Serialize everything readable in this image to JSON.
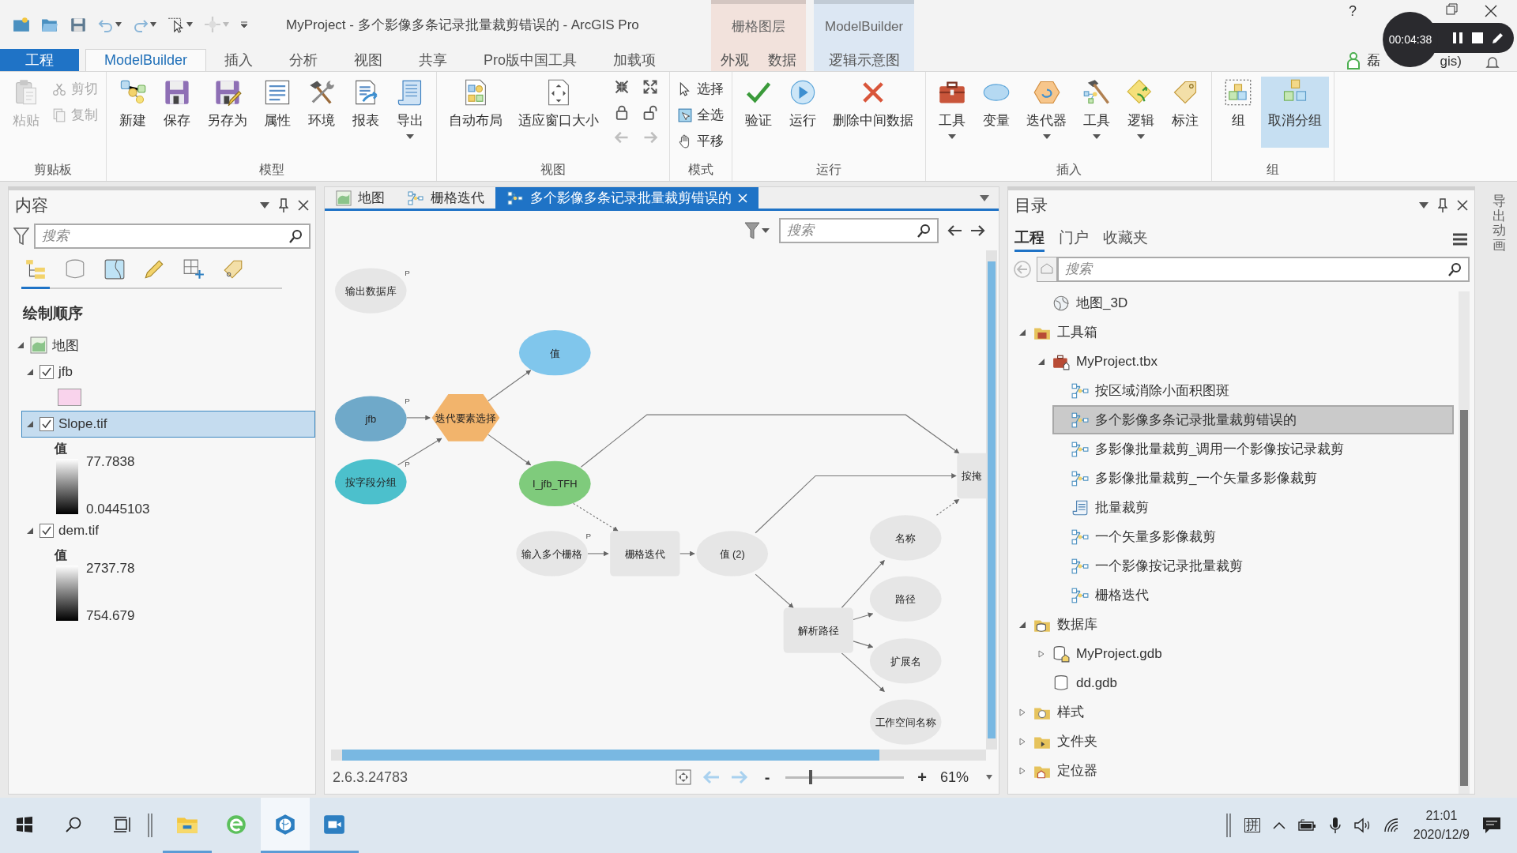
{
  "title_bar": {
    "title": "MyProject - 多个影像多条记录批量裁剪错误的 - ArcGIS Pro",
    "help": "?",
    "account": {
      "name_start": "磊",
      "name_end": "gis)"
    }
  },
  "recorder": {
    "time": "00:04:38"
  },
  "tabs": [
    {
      "label": "工程",
      "kind": "file",
      "selected": false
    },
    {
      "label": "ModelBuilder",
      "kind": "normal",
      "selected": true
    },
    {
      "label": "插入",
      "kind": "normal",
      "selected": false
    },
    {
      "label": "分析",
      "kind": "normal",
      "selected": false
    },
    {
      "label": "视图",
      "kind": "normal",
      "selected": false
    },
    {
      "label": "共享",
      "kind": "normal",
      "selected": false
    },
    {
      "label": "Pro版中国工具",
      "kind": "normal",
      "selected": false
    },
    {
      "label": "加载项",
      "kind": "normal",
      "selected": false
    }
  ],
  "context_groups": [
    {
      "label": "栅格图层",
      "color": "#f2e2dc",
      "tabs": [
        {
          "label": "外观",
          "selected": false
        },
        {
          "label": "数据",
          "selected": false
        }
      ]
    },
    {
      "label": "ModelBuilder",
      "color": "#dce7f3",
      "tabs": [
        {
          "label": "逻辑示意图",
          "selected": false
        }
      ]
    }
  ],
  "ribbon": [
    {
      "label": "剪贴板",
      "items": [
        {
          "label": "粘贴",
          "kind": "large",
          "disabled": true
        },
        {
          "label": "剪切",
          "kind": "small",
          "disabled": true
        },
        {
          "label": "复制",
          "kind": "small",
          "disabled": true
        }
      ]
    },
    {
      "label": "模型",
      "items": [
        {
          "label": "新建",
          "kind": "large"
        },
        {
          "label": "保存",
          "kind": "large"
        },
        {
          "label": "另存为",
          "kind": "large"
        },
        {
          "label": "属性",
          "kind": "large"
        },
        {
          "label": "环境",
          "kind": "large"
        },
        {
          "label": "报表",
          "kind": "large"
        },
        {
          "label": "导出",
          "kind": "large",
          "dropdown": true
        }
      ]
    },
    {
      "label": "视图",
      "items": [
        {
          "label": "自动布局",
          "kind": "large"
        },
        {
          "label": "适应窗口大小",
          "kind": "large"
        },
        {
          "kind": "icon"
        },
        {
          "kind": "icon"
        },
        {
          "kind": "icon"
        },
        {
          "kind": "icon"
        },
        {
          "kind": "icon",
          "disabled": true
        },
        {
          "kind": "icon",
          "disabled": true
        }
      ]
    },
    {
      "label": "模式",
      "items": [
        {
          "label": "选择",
          "kind": "small"
        },
        {
          "label": "全选",
          "kind": "small"
        },
        {
          "label": "平移",
          "kind": "small"
        }
      ]
    },
    {
      "label": "运行",
      "items": [
        {
          "label": "验证",
          "kind": "large"
        },
        {
          "label": "运行",
          "kind": "large"
        },
        {
          "label": "删除中间数据",
          "kind": "large"
        }
      ]
    },
    {
      "label": "插入",
      "items": [
        {
          "label": "工具",
          "kind": "large",
          "dropdown": true
        },
        {
          "label": "变量",
          "kind": "large"
        },
        {
          "label": "迭代器",
          "kind": "large",
          "dropdown": true
        },
        {
          "label": "工具",
          "kind": "large",
          "dropdown": true
        },
        {
          "label": "逻辑",
          "kind": "large",
          "dropdown": true
        },
        {
          "label": "标注",
          "kind": "large"
        }
      ]
    },
    {
      "label": "组",
      "items": [
        {
          "label": "组",
          "kind": "large"
        },
        {
          "label": "取消分组",
          "kind": "large",
          "highlighted": true
        }
      ]
    }
  ],
  "contents_pane": {
    "title": "内容",
    "search_placeholder": "搜索",
    "view_icons": [
      {
        "selected": true
      },
      {
        "selected": false
      },
      {
        "selected": false
      },
      {
        "selected": false
      },
      {
        "selected": false
      },
      {
        "selected": false
      }
    ],
    "heading": "绘制顺序",
    "tree": [
      {
        "label": "地图",
        "kind": "map",
        "expanded": true,
        "selected": false,
        "children": [
          {
            "label": "jfb",
            "kind": "layer",
            "checked": true,
            "expanded": true,
            "selected": false,
            "legend": {
              "kind": "swatch",
              "color": "#f9d3ec"
            }
          },
          {
            "label": "Slope.tif",
            "kind": "layer",
            "checked": true,
            "expanded": true,
            "selected": true,
            "legend": {
              "kind": "ramp",
              "title": "值",
              "high": "77.7838",
              "low": "0.0445103"
            }
          },
          {
            "label": "dem.tif",
            "kind": "layer",
            "checked": true,
            "expanded": true,
            "selected": false,
            "legend": {
              "kind": "ramp",
              "title": "值",
              "high": "2737.78",
              "low": "754.679"
            }
          }
        ]
      }
    ]
  },
  "view_tabs": [
    {
      "label": "地图",
      "kind": "map",
      "selected": false
    },
    {
      "label": "栅格迭代",
      "kind": "model",
      "selected": false
    },
    {
      "label": "多个影像多条记录批量裁剪错误的",
      "kind": "model",
      "selected": true
    }
  ],
  "model_view": {
    "search_placeholder": "搜索",
    "nodes": [
      {
        "label": "输出数据库",
        "kind": "variable",
        "color": "#e6e6e6",
        "marker": "P"
      },
      {
        "label": "值",
        "kind": "variable",
        "color": "#80c6ec"
      },
      {
        "label": "jfb",
        "kind": "variable",
        "color": "#6fa9c9",
        "marker": "P"
      },
      {
        "label": "迭代要素选择",
        "kind": "iterator",
        "color": "#f2b46c"
      },
      {
        "label": "按字段分组",
        "kind": "variable",
        "color": "#4cc0cc",
        "marker": "P"
      },
      {
        "label": "I_jfb_TFH",
        "kind": "variable",
        "color": "#7fcb7c"
      },
      {
        "label": "输入多个栅格",
        "kind": "variable",
        "color": "#e6e6e6",
        "marker": "P"
      },
      {
        "label": "栅格迭代",
        "kind": "tool",
        "color": "#e6e6e6"
      },
      {
        "label": "值 (2)",
        "kind": "variable",
        "color": "#e6e6e6"
      },
      {
        "label": "按掩",
        "kind": "tool",
        "color": "#e6e6e6"
      },
      {
        "label": "解析路径",
        "kind": "tool",
        "color": "#e6e6e6"
      },
      {
        "label": "名称",
        "kind": "variable",
        "color": "#e6e6e6"
      },
      {
        "label": "路径",
        "kind": "variable",
        "color": "#e6e6e6"
      },
      {
        "label": "扩展名",
        "kind": "variable",
        "color": "#e6e6e6"
      },
      {
        "label": "工作空间名称",
        "kind": "variable",
        "color": "#e6e6e6"
      }
    ],
    "version": "2.6.3.24783",
    "zoom_minus": "-",
    "zoom_plus": "+",
    "zoom_slider": {
      "level": 0.2
    },
    "zoom": "61%"
  },
  "catalog_pane": {
    "title": "目录",
    "tabs": [
      {
        "label": "工程",
        "selected": true
      },
      {
        "label": "门户",
        "selected": false
      },
      {
        "label": "收藏夹",
        "selected": false
      }
    ],
    "search_placeholder": "搜索",
    "tree": [
      {
        "label": "地图_3D",
        "kind": "map",
        "selected": false
      },
      {
        "label": "工具箱",
        "kind": "toolbox-folder",
        "expanded": true,
        "selected": false,
        "children": [
          {
            "label": "MyProject.tbx",
            "kind": "toolbox",
            "expanded": true,
            "selected": false,
            "children": [
              {
                "label": "按区域消除小面积图斑",
                "kind": "model",
                "selected": false
              },
              {
                "label": "多个影像多条记录批量裁剪错误的",
                "kind": "model",
                "selected": true
              },
              {
                "label": "多影像批量裁剪_调用一个影像按记录裁剪",
                "kind": "model",
                "selected": false
              },
              {
                "label": "多影像批量裁剪_一个矢量多影像裁剪",
                "kind": "model",
                "selected": false
              },
              {
                "label": "批量裁剪",
                "kind": "script",
                "selected": false
              },
              {
                "label": "一个矢量多影像裁剪",
                "kind": "model",
                "selected": false
              },
              {
                "label": "一个影像按记录批量裁剪",
                "kind": "model",
                "selected": false
              },
              {
                "label": "栅格迭代",
                "kind": "model",
                "selected": false
              }
            ]
          }
        ]
      },
      {
        "label": "数据库",
        "kind": "database-folder",
        "expanded": true,
        "selected": false,
        "children": [
          {
            "label": "MyProject.gdb",
            "kind": "gdb-home",
            "expanded": false,
            "selected": false
          },
          {
            "label": "dd.gdb",
            "kind": "gdb",
            "selected": false
          }
        ]
      },
      {
        "label": "样式",
        "kind": "style-folder",
        "expanded": false,
        "selected": false
      },
      {
        "label": "文件夹",
        "kind": "folder",
        "expanded": false,
        "selected": false
      },
      {
        "label": "定位器",
        "kind": "locator-folder",
        "expanded": false,
        "selected": false
      }
    ]
  },
  "side_strip": {
    "label": "导出动画"
  },
  "taskbar": {
    "apps": [
      {
        "kind": "explorer",
        "running": true,
        "focused": false
      },
      {
        "kind": "browser",
        "running": false,
        "focused": false
      },
      {
        "kind": "arcgis",
        "running": true,
        "focused": true
      },
      {
        "kind": "recorder",
        "running": true,
        "focused": false
      }
    ],
    "ime": "拼",
    "time": "21:01",
    "date": "2020/12/9"
  }
}
